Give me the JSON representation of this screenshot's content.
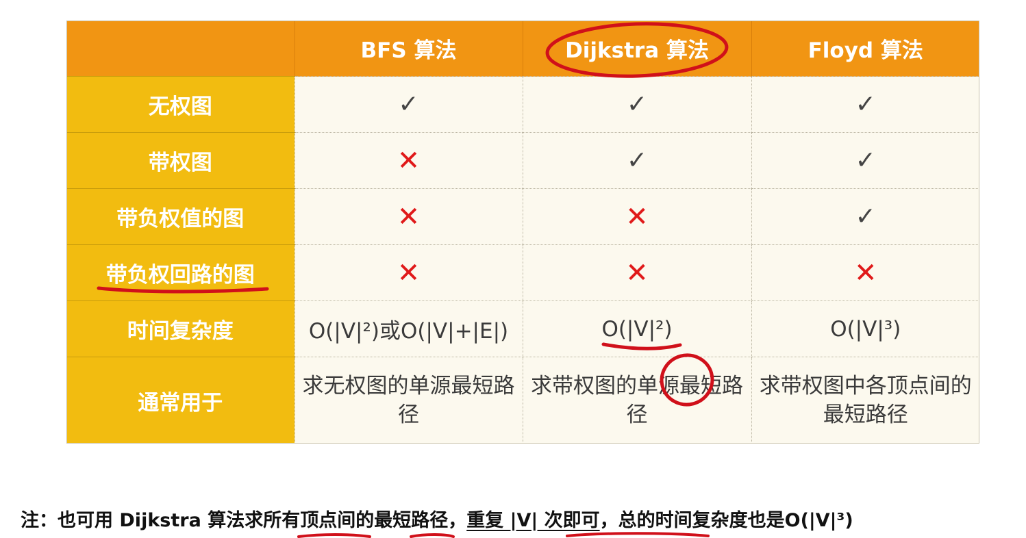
{
  "table": {
    "headers": [
      "",
      "BFS 算法",
      "Dijkstra 算法",
      "Floyd 算法"
    ],
    "rows": [
      {
        "label": "无权图",
        "cells": [
          "check",
          "check",
          "check"
        ]
      },
      {
        "label": "带权图",
        "cells": [
          "cross",
          "check",
          "check"
        ]
      },
      {
        "label": "带负权值的图",
        "cells": [
          "cross",
          "cross",
          "check"
        ]
      },
      {
        "label": "带负权回路的图",
        "cells": [
          "cross",
          "cross",
          "cross"
        ]
      },
      {
        "label": "时间复杂度",
        "cells": [
          "O(|V|²)或O(|V|+|E|)",
          "O(|V|²)",
          "O(|V|³)"
        ]
      },
      {
        "label": "通常用于",
        "cells": [
          "求无权图的单源最短路径",
          "求带权图的单源最短路径",
          "求带权图中各顶点间的最短路径"
        ]
      }
    ]
  },
  "symbols": {
    "check": "✓",
    "cross": "✕"
  },
  "note": {
    "prefix": "注：也可用 Dijkstra 算法求所有顶点间的最短路径，",
    "underlined": "重复 |V| 次即可",
    "suffix": "，总的时间复杂度也是O(|V|³)"
  },
  "colors": {
    "header_bg": "#f19513",
    "label_bg": "#f2bc10",
    "cell_bg": "#fcf9ee",
    "cross": "#e01919",
    "annotation": "#d0101a"
  }
}
